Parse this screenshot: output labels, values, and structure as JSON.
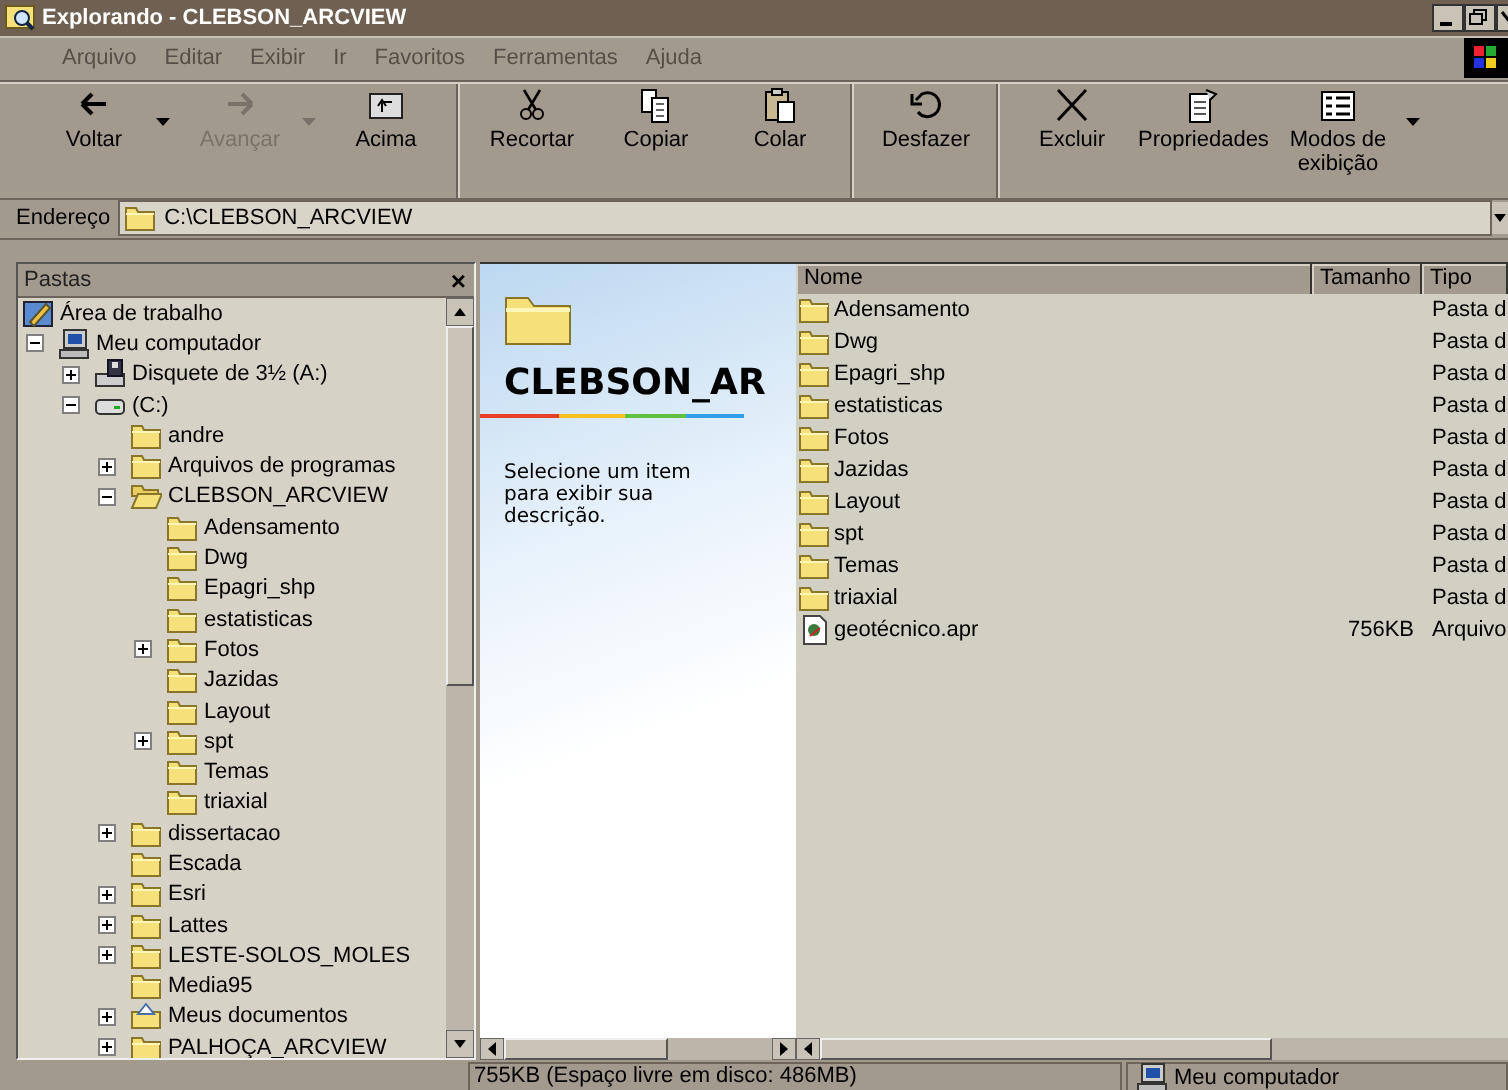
{
  "window": {
    "title": "Explorando - CLEBSON_ARCVIEW"
  },
  "menu": [
    "Arquivo",
    "Editar",
    "Exibir",
    "Ir",
    "Favoritos",
    "Ferramentas",
    "Ajuda"
  ],
  "toolbar": [
    [
      {
        "label": "Voltar",
        "disabled": false,
        "dropdown": true
      },
      {
        "label": "Avançar",
        "disabled": true,
        "dropdown": true
      },
      {
        "label": "Acima",
        "disabled": false,
        "dropdown": false
      }
    ],
    [
      {
        "label": "Recortar",
        "disabled": false,
        "dropdown": false
      },
      {
        "label": "Copiar",
        "disabled": false,
        "dropdown": false
      },
      {
        "label": "Colar",
        "disabled": false,
        "dropdown": false
      }
    ],
    [
      {
        "label": "Desfazer",
        "disabled": false,
        "dropdown": false
      }
    ],
    [
      {
        "label": "Excluir",
        "disabled": false,
        "dropdown": false
      },
      {
        "label": "Propriedades",
        "disabled": false,
        "dropdown": false
      },
      {
        "label": "Modos de exibição",
        "disabled": false,
        "dropdown": true
      }
    ]
  ],
  "address": {
    "label": "Endereço",
    "value": "C:\\CLEBSON_ARCVIEW"
  },
  "folders_pane": {
    "title": "Pastas",
    "close": "×"
  },
  "tree": [
    {
      "label": "Área de trabalho",
      "kind": "desktop",
      "children": [
        {
          "label": "Meu computador",
          "kind": "computer",
          "expanded": true,
          "children": [
            {
              "label": "Disquete de 3½ (A:)",
              "kind": "floppy",
              "expanded": false
            },
            {
              "label": "(C:)",
              "kind": "drive",
              "expanded": true,
              "children": [
                {
                  "label": "andre",
                  "kind": "folder"
                },
                {
                  "label": "Arquivos de programas",
                  "kind": "folder",
                  "expanded": false
                },
                {
                  "label": "CLEBSON_ARCVIEW",
                  "kind": "open-folder",
                  "expanded": true,
                  "children": [
                    {
                      "label": "Adensamento",
                      "kind": "folder"
                    },
                    {
                      "label": "Dwg",
                      "kind": "folder"
                    },
                    {
                      "label": "Epagri_shp",
                      "kind": "folder"
                    },
                    {
                      "label": "estatisticas",
                      "kind": "folder"
                    },
                    {
                      "label": "Fotos",
                      "kind": "folder",
                      "expanded": false
                    },
                    {
                      "label": "Jazidas",
                      "kind": "folder"
                    },
                    {
                      "label": "Layout",
                      "kind": "folder"
                    },
                    {
                      "label": "spt",
                      "kind": "folder",
                      "expanded": false
                    },
                    {
                      "label": "Temas",
                      "kind": "folder"
                    },
                    {
                      "label": "triaxial",
                      "kind": "folder"
                    }
                  ]
                },
                {
                  "label": "dissertacao",
                  "kind": "folder",
                  "expanded": false
                },
                {
                  "label": "Escada",
                  "kind": "folder"
                },
                {
                  "label": "Esri",
                  "kind": "folder",
                  "expanded": false
                },
                {
                  "label": "Lattes",
                  "kind": "folder",
                  "expanded": false
                },
                {
                  "label": "LESTE-SOLOS_MOLES",
                  "kind": "folder",
                  "expanded": false
                },
                {
                  "label": "Media95",
                  "kind": "folder"
                },
                {
                  "label": "Meus documentos",
                  "kind": "documents",
                  "expanded": false
                },
                {
                  "label": "PALHOÇA_ARCVIEW",
                  "kind": "folder",
                  "expanded": false
                }
              ]
            }
          ]
        }
      ]
    }
  ],
  "web_view": {
    "title": "CLEBSON_AR",
    "description": "Selecione um item para exibir sua descrição."
  },
  "list": {
    "columns": [
      "Nome",
      "Tamanho",
      "Tipo"
    ],
    "rows": [
      {
        "name": "Adensamento",
        "kind": "folder",
        "type": "Pasta d"
      },
      {
        "name": "Dwg",
        "kind": "folder",
        "type": "Pasta d"
      },
      {
        "name": "Epagri_shp",
        "kind": "folder",
        "type": "Pasta d"
      },
      {
        "name": "estatisticas",
        "kind": "folder",
        "type": "Pasta d"
      },
      {
        "name": "Fotos",
        "kind": "folder",
        "type": "Pasta d"
      },
      {
        "name": "Jazidas",
        "kind": "folder",
        "type": "Pasta d"
      },
      {
        "name": "Layout",
        "kind": "folder",
        "type": "Pasta d"
      },
      {
        "name": "spt",
        "kind": "folder",
        "type": "Pasta d"
      },
      {
        "name": "Temas",
        "kind": "folder",
        "type": "Pasta d"
      },
      {
        "name": "triaxial",
        "kind": "folder",
        "type": "Pasta d"
      },
      {
        "name": "geotécnico.apr",
        "kind": "file",
        "size": "756KB",
        "type": "Arquivo"
      }
    ]
  },
  "status_bar": {
    "free_space": "755KB (Espaço livre em disco: 486MB)",
    "location": "Meu computador"
  }
}
